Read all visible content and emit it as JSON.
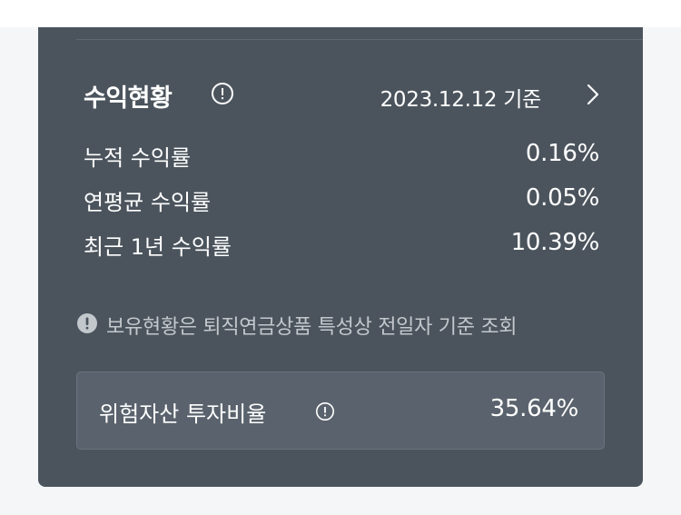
{
  "colors": {
    "card_background": "#4b545d",
    "page_background": "#f5f6f8",
    "risk_box_background": "#5a636d",
    "notice_text": "#c3c8cd"
  },
  "profit_status": {
    "title": "수익현황",
    "title_icon": "info-circle-icon",
    "base_date": "2023.12.12 기준",
    "detail_icon": "chevron-right-icon",
    "rows": [
      {
        "label": "누적 수익률",
        "value": "0.16%"
      },
      {
        "label": "연평균 수익률",
        "value": "0.05%"
      },
      {
        "label": "최근 1년 수익률",
        "value": "10.39%"
      }
    ]
  },
  "notice": {
    "icon": "exclamation-circle-icon",
    "text": "보유현황은 퇴직연금상품 특성상 전일자 기준 조회"
  },
  "risk_asset": {
    "label": "위험자산 투자비율",
    "icon": "info-circle-icon",
    "value": "35.64%"
  }
}
